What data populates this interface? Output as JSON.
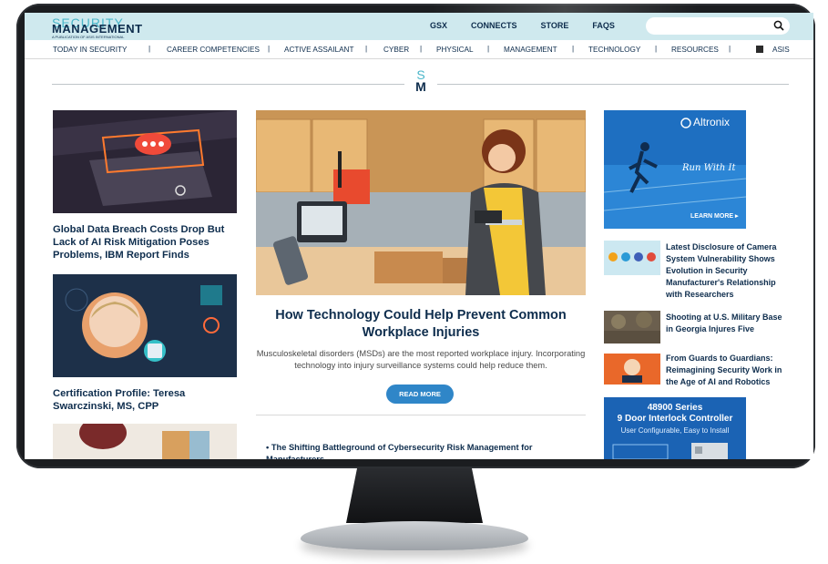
{
  "header": {
    "logo_top": "SECURITY",
    "logo_main": "MANAGEMENT",
    "logo_tagline": "A PUBLICATION OF ASIS INTERNATIONAL",
    "top_nav": [
      "GSX",
      "CONNECTS",
      "STORE",
      "FAQS"
    ],
    "search_placeholder": ""
  },
  "main_nav": [
    "TODAY IN SECURITY",
    "CAREER COMPETENCIES",
    "ACTIVE ASSAILANT",
    "CYBER",
    "PHYSICAL",
    "MANAGEMENT",
    "TECHNOLOGY",
    "RESOURCES",
    "ASIS"
  ],
  "section_logo": {
    "s": "S",
    "m": "M"
  },
  "left_articles": [
    {
      "title": "Global Data Breach Costs Drop But Lack of AI Risk Mitigation Poses Problems, IBM Report Finds"
    },
    {
      "title": "Certification Profile: Teresa Swarczinski, MS, CPP"
    }
  ],
  "feature": {
    "title": "How Technology Could Help Prevent Common Workplace Injuries",
    "description": "Musculoskeletal disorders (MSDs) are the most reported workplace injury. Incorporating technology into injury surveillance systems could help reduce them.",
    "cta": "READ MORE"
  },
  "feature_list": [
    "The Shifting Battleground of Cybersecurity Risk Management for Manufacturers"
  ],
  "ad_top": {
    "brand": "Altronix",
    "script": "Run With It",
    "cta": "LEARN MORE ▸"
  },
  "side_articles": [
    "Latest Disclosure of Camera System Vulnerability Shows Evolution in Security Manufacturer's Relationship with Researchers",
    "Shooting at U.S. Military Base in Georgia Injures Five",
    "From Guards to Guardians: Reimagining Security Work in the Age of AI and Robotics"
  ],
  "ad_bottom": {
    "line1": "48900 Series",
    "line2": "9 Door Interlock Controller",
    "line3": "User Configurable, Easy to Install"
  },
  "colors": {
    "navy": "#0e2d4d",
    "teal": "#4ab6c9",
    "button": "#2f86c8",
    "topbar": "#cfe9ee"
  }
}
